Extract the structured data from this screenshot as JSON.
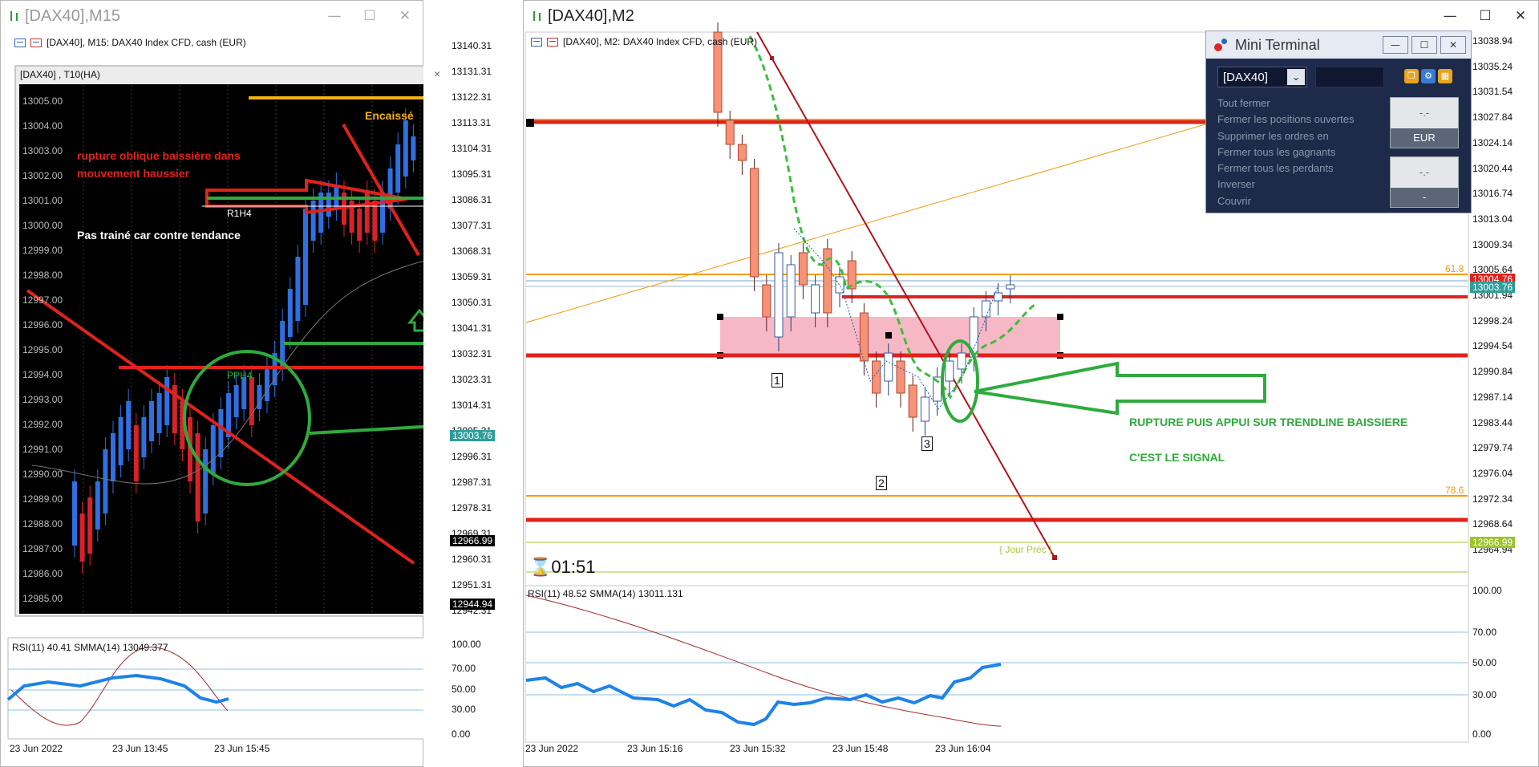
{
  "colors": {
    "green": "#2eab3c",
    "red": "#e0221c",
    "orange": "#f39c12",
    "blue": "#1f6fe5",
    "bg_black": "#000000"
  },
  "left_window": {
    "title": "[DAX40],M15",
    "chart_header": "[DAX40], M15:  DAX40 Index CFD, cash (EUR)",
    "inner_title": "[DAX40] , T10(HA)",
    "inner_close": "×",
    "price_axis": [
      "13140.31",
      "13131.31",
      "13122.31",
      "13113.31",
      "13104.31",
      "13095.31",
      "13086.31",
      "13077.31",
      "13068.31",
      "13059.31",
      "13050.31",
      "13041.31",
      "13032.31",
      "13023.31",
      "13014.31",
      "13005.31",
      "12996.31",
      "12987.31",
      "12978.31",
      "12969.31",
      "12960.31",
      "12951.31",
      "12942.31"
    ],
    "price_tags": {
      "current": "13003.76",
      "low1": "12966.99",
      "low2": "12944.94"
    },
    "inner_axis": [
      "13005.00",
      "13004.00",
      "13003.00",
      "13002.00",
      "13001.00",
      "13000.00",
      "12999.00",
      "12998.00",
      "12997.00",
      "12996.00",
      "12995.00",
      "12994.00",
      "12993.00",
      "12992.00",
      "12991.00",
      "12990.00",
      "12989.00",
      "12988.00",
      "12987.00",
      "12986.00",
      "12985.00"
    ],
    "annotations": {
      "encaisse": "Encaissé",
      "rupture": "rupture oblique baissière dans",
      "rupture2": "mouvement haussier",
      "r1h4": "R1H4",
      "pas_traine": "Pas trainé car contre tendance",
      "pph4": "PPH4"
    },
    "rsi_label": "RSI(11) 40.41 SMMA(14) 13049.377",
    "rsi_axis": [
      "100.00",
      "70.00",
      "50.00",
      "30.00",
      "0.00"
    ],
    "time_axis": [
      "23 Jun 2022",
      "23 Jun 13:45",
      "23 Jun 15:45"
    ]
  },
  "right_window": {
    "title": "[DAX40],M2",
    "chart_header": "[DAX40], M2:  DAX40 Index CFD, cash (EUR)",
    "price_axis": [
      "13038.94",
      "13035.24",
      "13031.54",
      "13027.84",
      "13024.14",
      "13020.44",
      "13016.74",
      "13013.04",
      "13009.34",
      "13005.64",
      "13001.94",
      "12998.24",
      "12994.54",
      "12990.84",
      "12987.14",
      "12983.44",
      "12979.74",
      "12976.04",
      "12972.34",
      "12968.64",
      "12964.94"
    ],
    "price_tags": {
      "tag1": "13004.76",
      "tag2": "13003.76",
      "tag3": "12966.99"
    },
    "fib_labels": {
      "f618": "61.8",
      "f786": "78.6"
    },
    "jour_prec": "{ Jour Préc }",
    "timer": "01:51",
    "wave_labels": [
      "1",
      "2",
      "3"
    ],
    "annotations": {
      "signal1": "RUPTURE PUIS APPUI SUR TRENDLINE BAISSIERE",
      "signal2": "C'EST LE SIGNAL"
    },
    "rsi_label": "RSI(11) 48.52 SMMA(14) 13011.131",
    "rsi_axis": [
      "100.00",
      "70.00",
      "50.00",
      "30.00",
      "0.00"
    ],
    "time_axis": [
      "23 Jun 2022",
      "23 Jun 15:16",
      "23 Jun 15:32",
      "23 Jun 15:48",
      "23 Jun 16:04"
    ]
  },
  "mini_terminal": {
    "title": "Mini Terminal",
    "symbol": "[DAX40]",
    "menu": [
      "Tout fermer",
      "Fermer les positions ouvertes",
      "Supprimer les ordres en",
      "Fermer tous les gagnants",
      "Fermer tous les perdants",
      "Inverser",
      "Couvrir"
    ],
    "box1_top": "-.-",
    "box1_bottom": "EUR",
    "box2_top": "-.-",
    "box2_bottom": "-"
  }
}
